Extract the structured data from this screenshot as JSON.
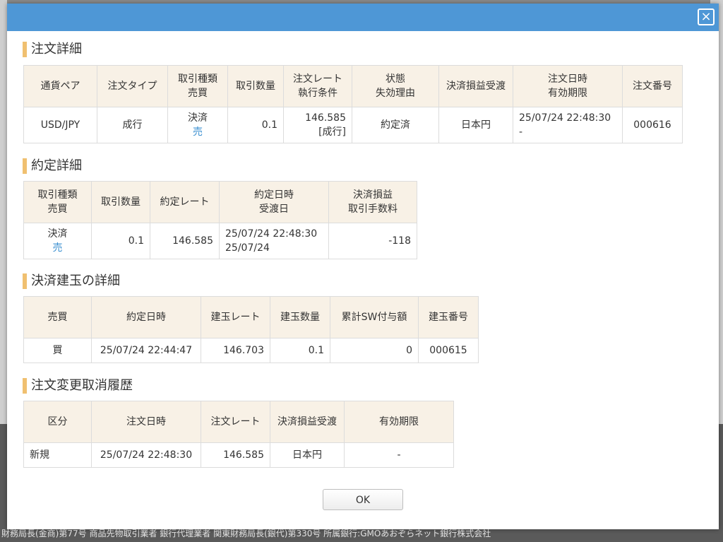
{
  "modal": {
    "close_label": "×",
    "ok_label": "OK"
  },
  "order_detail": {
    "title": "注文詳細",
    "headers": [
      [
        "通貨ペア"
      ],
      [
        "注文タイプ"
      ],
      [
        "取引種類",
        "売買"
      ],
      [
        "取引数量"
      ],
      [
        "注文レート",
        "執行条件"
      ],
      [
        "状態",
        "失効理由"
      ],
      [
        "決済損益受渡"
      ],
      [
        "注文日時",
        "有効期限"
      ],
      [
        "注文番号"
      ]
    ],
    "row": {
      "pair": "USD/JPY",
      "type": "成行",
      "trade_kind": "決済",
      "side": "売",
      "quantity": "0.1",
      "rate": "146.585",
      "condition": "[成行]",
      "status": "約定済",
      "settlement": "日本円",
      "order_datetime": "25/07/24 22:48:30",
      "expiry": "-",
      "order_no": "000616"
    }
  },
  "execution_detail": {
    "title": "約定詳細",
    "headers": [
      [
        "取引種類",
        "売買"
      ],
      [
        "取引数量"
      ],
      [
        "約定レート"
      ],
      [
        "約定日時",
        "受渡日"
      ],
      [
        "決済損益",
        "取引手数料"
      ]
    ],
    "row": {
      "trade_kind": "決済",
      "side": "売",
      "quantity": "0.1",
      "rate": "146.585",
      "exec_datetime": "25/07/24 22:48:30",
      "delivery_date": "25/07/24",
      "pnl": "-118"
    }
  },
  "position_detail": {
    "title": "決済建玉の詳細",
    "headers": [
      "売買",
      "約定日時",
      "建玉レート",
      "建玉数量",
      "累計SW付与額",
      "建玉番号"
    ],
    "row": {
      "side": "買",
      "exec_datetime": "25/07/24 22:44:47",
      "rate": "146.703",
      "quantity": "0.1",
      "swap_total": "0",
      "position_no": "000615"
    }
  },
  "history": {
    "title": "注文変更取消履歴",
    "headers": [
      "区分",
      "注文日時",
      "注文レート",
      "決済損益受渡",
      "有効期限"
    ],
    "row": {
      "category": "新規",
      "order_datetime": "25/07/24 22:48:30",
      "rate": "146.585",
      "settlement": "日本円",
      "expiry": "-"
    }
  },
  "footer": {
    "text": "財務局長(金商)第77号 商品先物取引業者 銀行代理業者 関東財務局長(銀代)第330号 所属銀行:GMOあおぞらネット銀行株式会社"
  }
}
